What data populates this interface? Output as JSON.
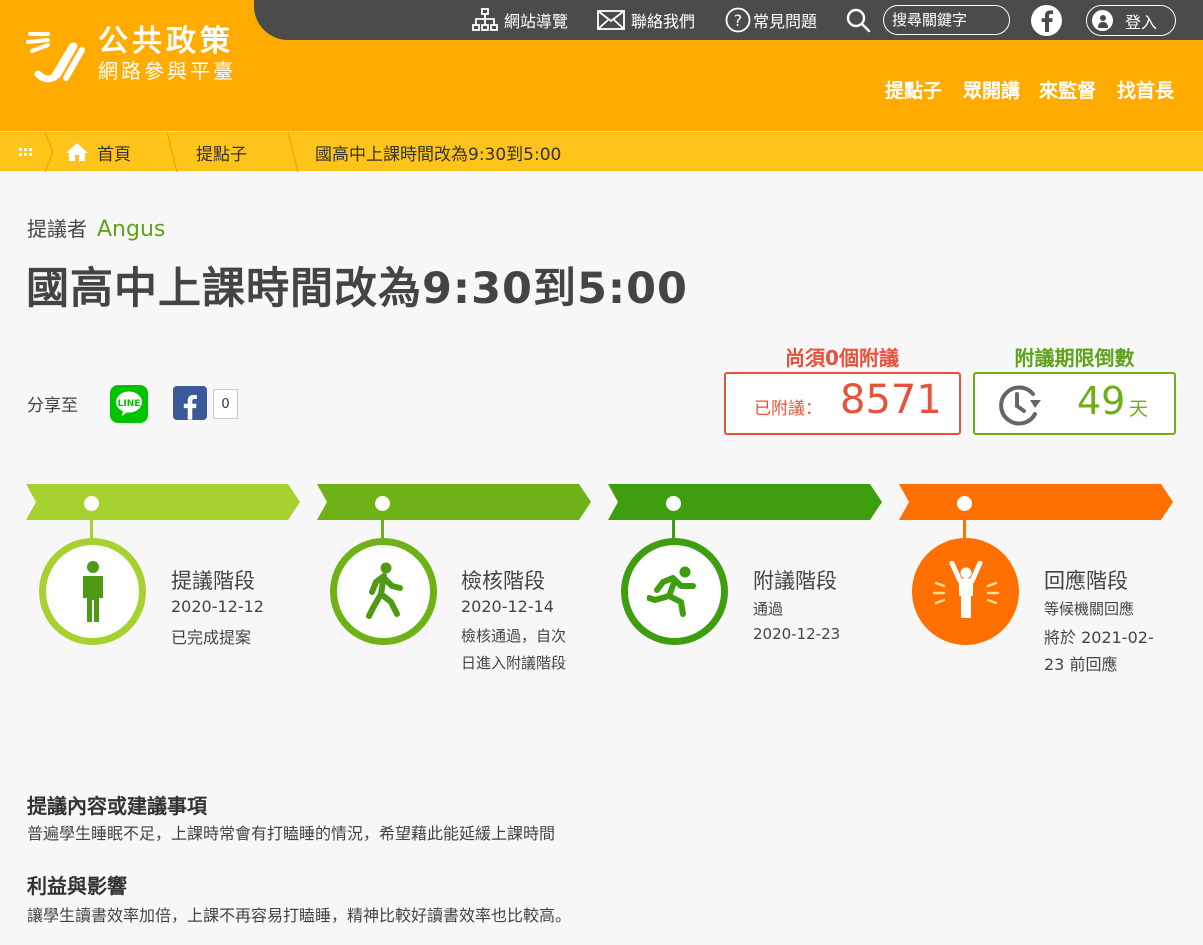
{
  "header": {
    "logo_title": "公共政策",
    "logo_subtitle": "網路參與平臺",
    "top_links": [
      {
        "label": "網站導覽",
        "icon": "sitemap-icon"
      },
      {
        "label": "聯絡我們",
        "icon": "mail-icon"
      },
      {
        "label": "常見問題",
        "icon": "question-icon"
      }
    ],
    "search_placeholder": "搜尋關鍵字",
    "login_label": "登入",
    "main_nav": [
      "提點子",
      "眾開講",
      "來監督",
      "找首長"
    ],
    "active_nav": "提點子"
  },
  "breadcrumb": {
    "items": [
      "首頁",
      "提點子",
      "國高中上課時間改為9:30到5:00"
    ]
  },
  "proposal": {
    "proposer_label": "提議者",
    "proposer_name": "Angus",
    "title": "國高中上課時間改為9:30到5:00"
  },
  "share": {
    "label": "分享至",
    "fb_count": "0"
  },
  "stats": {
    "need_label": "尚須0個附議",
    "seconded_label": "已附議：",
    "seconded_count": "8571",
    "deadline_label": "附議期限倒數",
    "days_left": "49",
    "days_unit": "天"
  },
  "stages": [
    {
      "title": "提議階段",
      "lines": [
        "2020-12-12",
        "已完成提案"
      ],
      "color": "#a7d130",
      "icon": "standing-person-icon"
    },
    {
      "title": "檢核階段",
      "lines": [
        "2020-12-14",
        "檢核通過，自次",
        "日進入附議階段"
      ],
      "color": "#6fb218",
      "icon": "walking-person-icon"
    },
    {
      "title": "附議階段",
      "lines": [
        "通過",
        "2020-12-23"
      ],
      "color": "#3f9e10",
      "icon": "running-person-icon"
    },
    {
      "title": "回應階段",
      "lines": [
        "等候機關回應",
        "將於  2021-02-",
        "23  前回應"
      ],
      "color": "#ff7000",
      "icon": "cheering-person-icon"
    }
  ],
  "sections": [
    {
      "title": "提議內容或建議事項",
      "text": "普遍學生睡眠不足，上課時常會有打瞌睡的情況，希望藉此能延緩上課時間"
    },
    {
      "title": "利益與影響",
      "text": "讓學生讀書效率加倍，上課不再容易打瞌睡，精神比較好讀書效率也比較高。"
    }
  ],
  "colors": {
    "header_orange": "#ffab00",
    "topbar_gray": "#4b4b4b",
    "breadcrumb_yellow": "#fec419",
    "accent_red": "#e5533d",
    "accent_green": "#6fae17"
  }
}
